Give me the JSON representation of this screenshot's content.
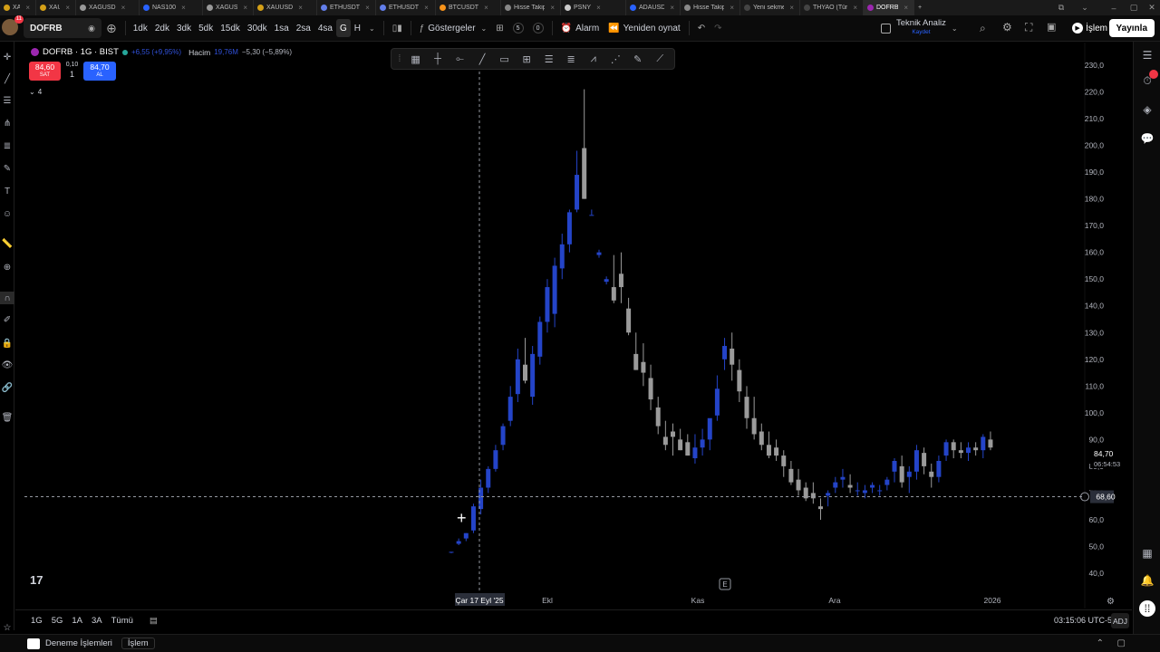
{
  "browser_tabs": [
    {
      "label": "XAUUSD",
      "color": "#d4a017"
    },
    {
      "label": "XAUUSD",
      "color": "#d4a017"
    },
    {
      "label": "XAGUSD",
      "color": "#999999"
    },
    {
      "label": "NAS100",
      "color": "#2962ff"
    },
    {
      "label": "XAGUSD",
      "color": "#999999"
    },
    {
      "label": "XAUUSD",
      "color": "#d4a017"
    },
    {
      "label": "ETHUSDT",
      "color": "#627eea"
    },
    {
      "label": "ETHUSDT",
      "color": "#627eea"
    },
    {
      "label": "BTCUSDT",
      "color": "#f7931a"
    },
    {
      "label": "Hisse Takip",
      "color": "#888888"
    },
    {
      "label": "PSNY",
      "color": "#cccccc"
    },
    {
      "label": "ADAUSD",
      "color": "#2962ff"
    },
    {
      "label": "Hisse Takip",
      "color": "#888888"
    },
    {
      "label": "Yeni sekme",
      "color": "#444444"
    },
    {
      "label": "THYAO (Türk Ha",
      "color": "#444444"
    },
    {
      "label": "DOFRB",
      "color": "#9c27b0"
    }
  ],
  "toolbar": {
    "avatar_badge": "11",
    "symbol": "DOFRB",
    "intervals": [
      "1dk",
      "2dk",
      "3dk",
      "5dk",
      "15dk",
      "30dk",
      "1sa",
      "2sa",
      "4sa",
      "G",
      "H"
    ],
    "selected_interval": "G",
    "indicators_label": "Göstergeler",
    "alarm_label": "Alarm",
    "replay_label": "Yeniden oynat",
    "badge_s": "5",
    "badge_o": "0",
    "layout_title": "Teknik Analiz",
    "layout_sub": "Kaydet",
    "trade_label": "İşlem",
    "publish_label": "Yayınla"
  },
  "legend": {
    "title": "DOFRB · 1G · BIST",
    "change": "+6,55 (+9,95%)",
    "volume_label": "Hacim",
    "volume_value": "19,76M",
    "volume_change": "−5,30 (−5,89%)",
    "sell_price": "84,60",
    "sell_label": "SAT",
    "spread": "0,10",
    "qty": "1",
    "buy_price": "84,70",
    "buy_label": "AL",
    "collapsed_count": "4"
  },
  "chart_data": {
    "type": "candlestick",
    "y_ticks": [
      "230,0",
      "220,0",
      "210,0",
      "200,0",
      "190,0",
      "180,0",
      "170,0",
      "160,0",
      "150,0",
      "140,0",
      "130,0",
      "120,0",
      "110,0",
      "100,0",
      "90,0",
      "80,0",
      "70,0",
      "60,0",
      "50,0",
      "40,0"
    ],
    "x_ticks": [
      "Çar 17 Eyl '25",
      "Ekl",
      "Kas",
      "Ara",
      "2026"
    ],
    "ylim": [
      40,
      230
    ],
    "last_price": "84,70",
    "countdown": "06:54:53",
    "crosshair_price": "68,60",
    "crosshair_date": "Çar 17 Eyl '25",
    "up_color": "#2444c8",
    "down_color": "#9a9a9a",
    "candles": [
      [
        48,
        48,
        47.5,
        48
      ],
      [
        51,
        53,
        50.5,
        52
      ],
      [
        53,
        55,
        52,
        55
      ],
      [
        56,
        66,
        55,
        65
      ],
      [
        64,
        75,
        62,
        72
      ],
      [
        72,
        80,
        70,
        79
      ],
      [
        79,
        88,
        78,
        86
      ],
      [
        88,
        96,
        86,
        95
      ],
      [
        97,
        110,
        95,
        106
      ],
      [
        107,
        124,
        104,
        120
      ],
      [
        118,
        128,
        111,
        112
      ],
      [
        106,
        125,
        103,
        122
      ],
      [
        121,
        136,
        118,
        134
      ],
      [
        134,
        150,
        130,
        147
      ],
      [
        137,
        158,
        132,
        155
      ],
      [
        154,
        167,
        150,
        163
      ],
      [
        163,
        176,
        160,
        175
      ],
      [
        176,
        198,
        175,
        189
      ],
      [
        199,
        221,
        180,
        180
      ],
      [
        174,
        176,
        174,
        174
      ],
      [
        159,
        161,
        158,
        160
      ],
      [
        149,
        151,
        148,
        150
      ],
      [
        147,
        159,
        141,
        142
      ],
      [
        152,
        160,
        141,
        147
      ],
      [
        139,
        143,
        129,
        130
      ],
      [
        122,
        130,
        116,
        116
      ],
      [
        119,
        126,
        110,
        115
      ],
      [
        113,
        118,
        101,
        105
      ],
      [
        102,
        106,
        92,
        95
      ],
      [
        91,
        97,
        86,
        88
      ],
      [
        93,
        96,
        84,
        91
      ],
      [
        90,
        94,
        86,
        86
      ],
      [
        89,
        92,
        84,
        84
      ],
      [
        83,
        92,
        81,
        87
      ],
      [
        87,
        94,
        84,
        90
      ],
      [
        90,
        97,
        86,
        98
      ],
      [
        99,
        114,
        97,
        109
      ],
      [
        120,
        128,
        116,
        125
      ],
      [
        124,
        130,
        112,
        118
      ],
      [
        116,
        120,
        104,
        108
      ],
      [
        106,
        110,
        94,
        98
      ],
      [
        98,
        106,
        90,
        92
      ],
      [
        93,
        96,
        86,
        88
      ],
      [
        88,
        93,
        83,
        84
      ],
      [
        87,
        90,
        82,
        84
      ],
      [
        84,
        86,
        76,
        80
      ],
      [
        79,
        82,
        73,
        74
      ],
      [
        75,
        79,
        69,
        71
      ],
      [
        72,
        74,
        67,
        68
      ],
      [
        70,
        74,
        66,
        68
      ],
      [
        65,
        68,
        60,
        64
      ],
      [
        69,
        71,
        65,
        70
      ],
      [
        72,
        76,
        70,
        74
      ],
      [
        75,
        79,
        72,
        76
      ],
      [
        73,
        77,
        70,
        72
      ],
      [
        71,
        74,
        69,
        71
      ],
      [
        70,
        73,
        68,
        71
      ],
      [
        72,
        74,
        70,
        73
      ],
      [
        71,
        73,
        69,
        71
      ],
      [
        73,
        76,
        71,
        75
      ],
      [
        78,
        83,
        74,
        82
      ],
      [
        80,
        84,
        72,
        74
      ],
      [
        76,
        80,
        70,
        78
      ],
      [
        78,
        88,
        75,
        86
      ],
      [
        85,
        87,
        77,
        80
      ],
      [
        78,
        81,
        72,
        76
      ],
      [
        76,
        84,
        74,
        82
      ],
      [
        84,
        90,
        82,
        89
      ],
      [
        89,
        90,
        83,
        86
      ],
      [
        86,
        89,
        83,
        85
      ],
      [
        85,
        89,
        82,
        87
      ],
      [
        87,
        89,
        84,
        86
      ],
      [
        86,
        92,
        83,
        91
      ],
      [
        90,
        93,
        86,
        87
      ]
    ]
  }
}
